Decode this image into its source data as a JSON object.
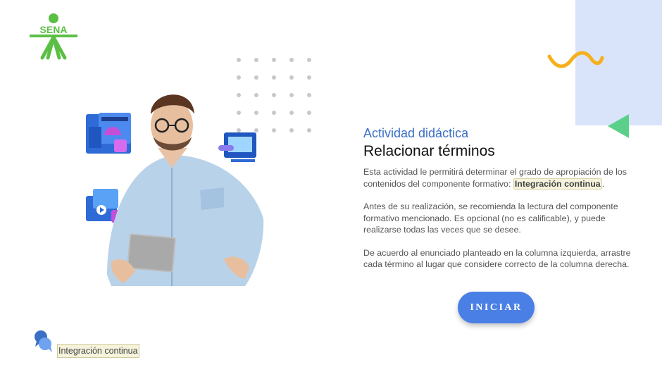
{
  "logo": {
    "text": "SENA",
    "color": "#5bbf46"
  },
  "colors": {
    "accent_blue": "#3a6fc6",
    "button_blue": "#4a7fe6",
    "block_blue": "#d9e4fb",
    "wave_yellow": "#f5b01c",
    "triangle_green": "#5bd08a",
    "highlight": "#f5f3dc"
  },
  "activity": {
    "subtitle": "Actividad didáctica",
    "title": "Relacionar términos",
    "p1_prefix": "Esta actividad le permitirá determinar el grado de apropiación de los contenidos del componente formativo: ",
    "p1_highlight": "Integración continua",
    "p1_suffix": ".",
    "p2": "Antes de su realización, se recomienda la lectura del componente formativo mencionado.  Es opcional (no es calificable), y puede realizarse todas las veces que se desee.",
    "p3": "De acuerdo al enunciado planteado en la columna izquierda, arrastre cada término al lugar que considere correcto de la columna derecha."
  },
  "start_button": {
    "label": "INICIAR"
  },
  "breadcrumb": {
    "label": "Integración continua"
  },
  "icons": [
    "sena-logo",
    "wave-decoration",
    "triangle-decoration",
    "chat-bubbles-icon",
    "tablet-person-illustration"
  ]
}
